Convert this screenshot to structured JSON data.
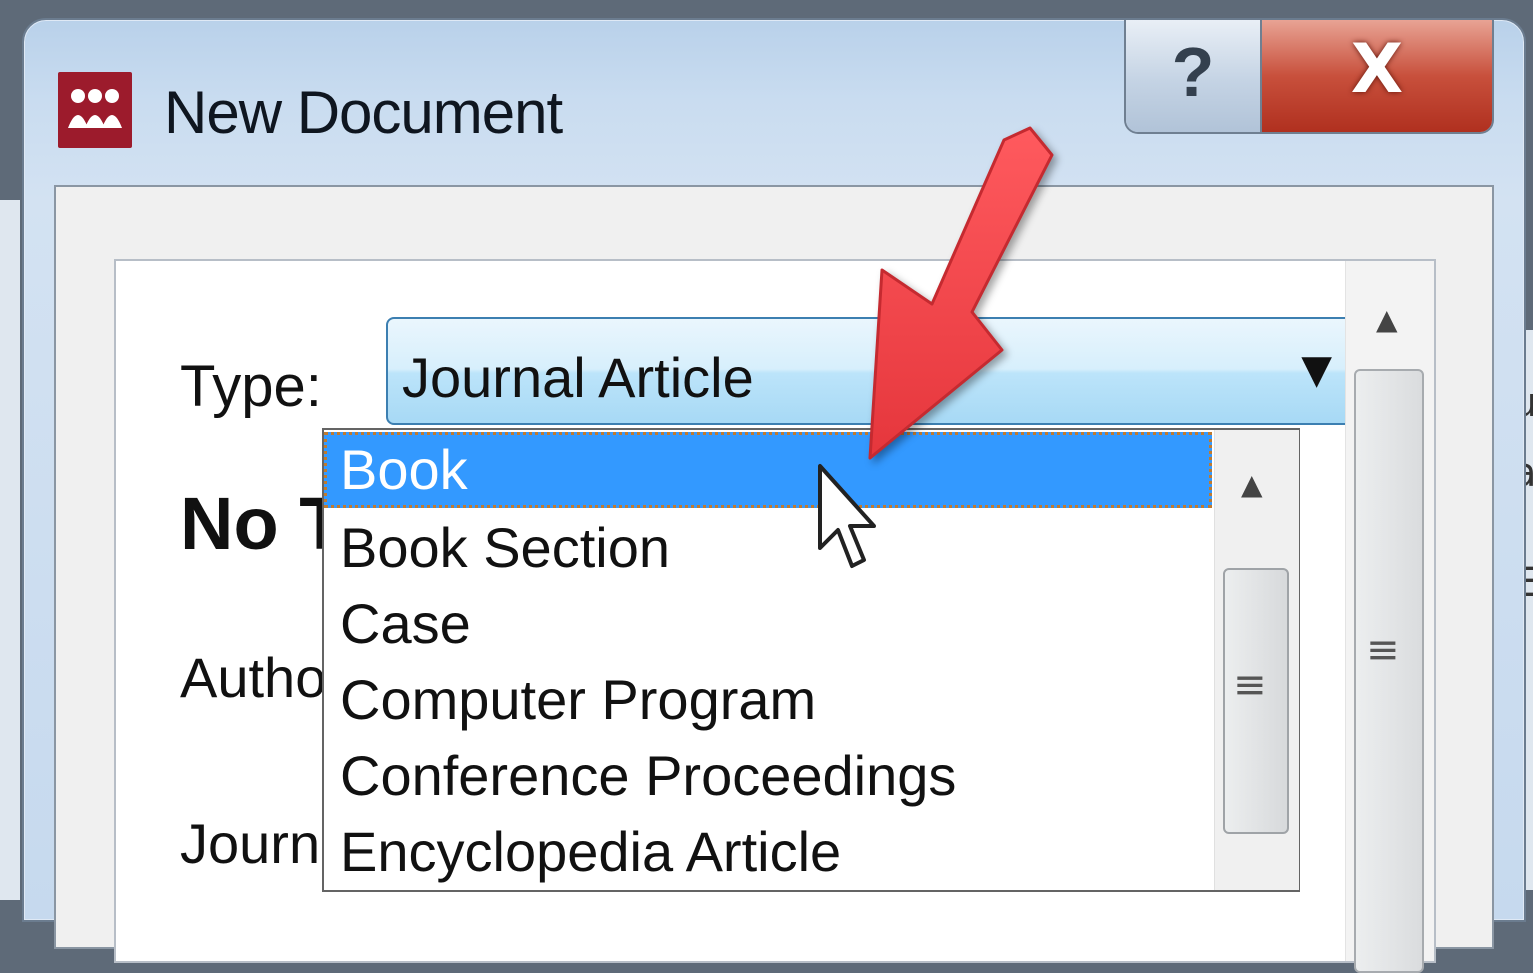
{
  "window": {
    "title": "New Document",
    "help_button": "?",
    "close_button": "X"
  },
  "form": {
    "type_label": "Type:",
    "title_placeholder": "No T",
    "author_label": "Author",
    "journal_label": "Journa"
  },
  "type_select": {
    "selected_value": "Journal Article",
    "options": [
      "Book",
      "Book Section",
      "Case",
      "Computer Program",
      "Conference Proceedings",
      "Encyclopedia Article"
    ],
    "highlighted_option": "Book"
  },
  "background_edge_text": [
    "u",
    "a",
    "E",
    "("
  ],
  "colors": {
    "app_logo": "#9c1b2c",
    "selection": "#3399ff",
    "close_button": "#c8503c",
    "annotation_arrow": "#f0464b"
  },
  "icons": {
    "app": "mendeley-logo-icon",
    "help": "question-mark-icon",
    "close": "close-x-icon",
    "dropdown": "triangle-down-icon",
    "scroll_up": "triangle-up-icon",
    "scroll_grip": "grip-lines-icon",
    "pointer": "mouse-cursor-icon",
    "annotation": "red-arrow-icon"
  }
}
